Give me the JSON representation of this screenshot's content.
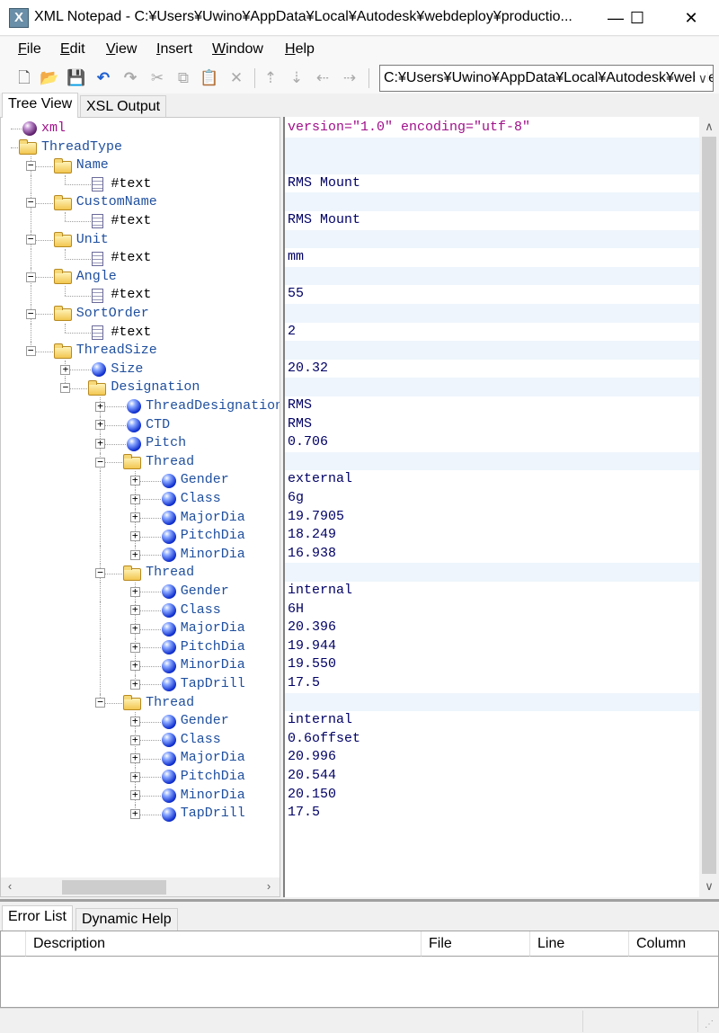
{
  "window": {
    "title": "XML Notepad - C:¥Users¥Uwino¥AppData¥Local¥Autodesk¥webdeploy¥productio...",
    "app_icon": "X",
    "minimize": "—",
    "maximize": "☐",
    "close": "✕"
  },
  "menu": [
    {
      "label": "File",
      "key": "F",
      "rest": "ile"
    },
    {
      "label": "Edit",
      "key": "E",
      "rest": "dit"
    },
    {
      "label": "View",
      "key": "V",
      "rest": "iew"
    },
    {
      "label": "Insert",
      "key": "I",
      "rest": "nsert"
    },
    {
      "label": "Window",
      "key": "W",
      "rest": "indow"
    },
    {
      "label": "Help",
      "key": "H",
      "rest": "elp"
    }
  ],
  "toolbar": {
    "icons": [
      "new-icon",
      "open-icon",
      "save-icon",
      "undo-icon",
      "redo-icon",
      "cut-icon",
      "copy-icon",
      "paste-icon",
      "delete-icon",
      "nudge-up-icon",
      "nudge-down-icon",
      "nudge-left-icon",
      "nudge-right-icon"
    ],
    "path": "C:¥Users¥Uwino¥AppData¥Local¥Autodesk¥webdeploy¥production"
  },
  "tabs": {
    "tree_view": "Tree View",
    "xsl_output": "XSL Output"
  },
  "tree": [
    {
      "label": "xml",
      "value": "version=\"1.0\" encoding=\"utf-8\"",
      "type": "pi",
      "level": 0,
      "exp": ""
    },
    {
      "label": "ThreadType",
      "value": "",
      "type": "folder",
      "level": 0,
      "exp": ""
    },
    {
      "label": "Name",
      "value": "",
      "type": "folder",
      "level": 1,
      "exp": "-"
    },
    {
      "label": "#text",
      "value": "RMS Mount",
      "type": "textnode",
      "level": 2,
      "exp": ""
    },
    {
      "label": "CustomName",
      "value": "",
      "type": "folder",
      "level": 1,
      "exp": "-"
    },
    {
      "label": "#text",
      "value": "RMS Mount",
      "type": "textnode",
      "level": 2,
      "exp": ""
    },
    {
      "label": "Unit",
      "value": "",
      "type": "folder",
      "level": 1,
      "exp": "-"
    },
    {
      "label": "#text",
      "value": "mm",
      "type": "textnode",
      "level": 2,
      "exp": ""
    },
    {
      "label": "Angle",
      "value": "",
      "type": "folder",
      "level": 1,
      "exp": "-"
    },
    {
      "label": "#text",
      "value": "55",
      "type": "textnode",
      "level": 2,
      "exp": ""
    },
    {
      "label": "SortOrder",
      "value": "",
      "type": "folder",
      "level": 1,
      "exp": "-"
    },
    {
      "label": "#text",
      "value": "2",
      "type": "textnode",
      "level": 2,
      "exp": ""
    },
    {
      "label": "ThreadSize",
      "value": "",
      "type": "folder",
      "level": 1,
      "exp": "-"
    },
    {
      "label": "Size",
      "value": "20.32",
      "type": "attr",
      "level": 2,
      "exp": "+"
    },
    {
      "label": "Designation",
      "value": "",
      "type": "folder",
      "level": 2,
      "exp": "-"
    },
    {
      "label": "ThreadDesignation",
      "value": "RMS",
      "type": "attr",
      "level": 3,
      "exp": "+"
    },
    {
      "label": "CTD",
      "value": "RMS",
      "type": "attr",
      "level": 3,
      "exp": "+"
    },
    {
      "label": "Pitch",
      "value": "0.706",
      "type": "attr",
      "level": 3,
      "exp": "+"
    },
    {
      "label": "Thread",
      "value": "",
      "type": "folder",
      "level": 3,
      "exp": "-"
    },
    {
      "label": "Gender",
      "value": "external",
      "type": "attr",
      "level": 4,
      "exp": "+"
    },
    {
      "label": "Class",
      "value": "6g",
      "type": "attr",
      "level": 4,
      "exp": "+"
    },
    {
      "label": "MajorDia",
      "value": "19.7905",
      "type": "attr",
      "level": 4,
      "exp": "+"
    },
    {
      "label": "PitchDia",
      "value": "18.249",
      "type": "attr",
      "level": 4,
      "exp": "+"
    },
    {
      "label": "MinorDia",
      "value": "16.938",
      "type": "attr",
      "level": 4,
      "exp": "+"
    },
    {
      "label": "Thread",
      "value": "",
      "type": "folder",
      "level": 3,
      "exp": "-"
    },
    {
      "label": "Gender",
      "value": "internal",
      "type": "attr",
      "level": 4,
      "exp": "+"
    },
    {
      "label": "Class",
      "value": "6H",
      "type": "attr",
      "level": 4,
      "exp": "+"
    },
    {
      "label": "MajorDia",
      "value": "20.396",
      "type": "attr",
      "level": 4,
      "exp": "+"
    },
    {
      "label": "PitchDia",
      "value": "19.944",
      "type": "attr",
      "level": 4,
      "exp": "+"
    },
    {
      "label": "MinorDia",
      "value": "19.550",
      "type": "attr",
      "level": 4,
      "exp": "+"
    },
    {
      "label": "TapDrill",
      "value": "17.5",
      "type": "attr",
      "level": 4,
      "exp": "+"
    },
    {
      "label": "Thread",
      "value": "",
      "type": "folder",
      "level": 3,
      "exp": "-"
    },
    {
      "label": "Gender",
      "value": "internal",
      "type": "attr",
      "level": 4,
      "exp": "+"
    },
    {
      "label": "Class",
      "value": "0.6offset",
      "type": "attr",
      "level": 4,
      "exp": "+"
    },
    {
      "label": "MajorDia",
      "value": "20.996",
      "type": "attr",
      "level": 4,
      "exp": "+"
    },
    {
      "label": "PitchDia",
      "value": "20.544",
      "type": "attr",
      "level": 4,
      "exp": "+"
    },
    {
      "label": "MinorDia",
      "value": "20.150",
      "type": "attr",
      "level": 4,
      "exp": "+"
    },
    {
      "label": "TapDrill",
      "value": "17.5",
      "type": "attr",
      "level": 4,
      "exp": "+"
    }
  ],
  "bottom_tabs": {
    "error_list": "Error List",
    "dynamic_help": "Dynamic Help"
  },
  "error_table": {
    "columns": [
      "Description",
      "File",
      "Line",
      "Column"
    ]
  }
}
